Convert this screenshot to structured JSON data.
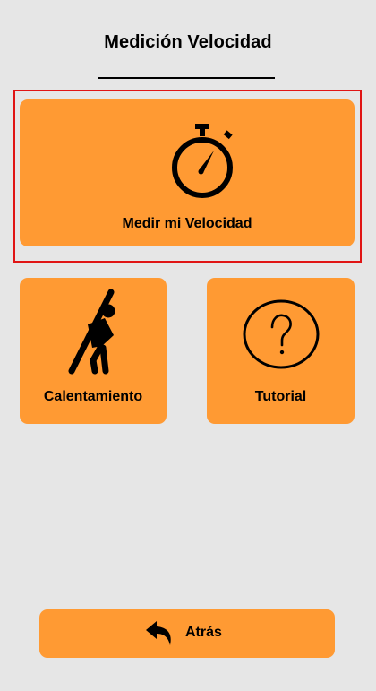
{
  "header": {
    "title": "Medición Velocidad"
  },
  "menu": {
    "measure": {
      "label": "Medir mi Velocidad",
      "icon": "stopwatch-icon"
    },
    "warmup": {
      "label": "Calentamiento",
      "icon": "stretching-person-icon"
    },
    "tutorial": {
      "label": "Tutorial",
      "icon": "question-mark-icon"
    }
  },
  "back": {
    "label": "Atrás",
    "icon": "back-arrow-icon"
  },
  "colors": {
    "background": "#e6e6e6",
    "tile": "#ff9a33",
    "highlight": "#e01515",
    "ink": "#000000"
  }
}
